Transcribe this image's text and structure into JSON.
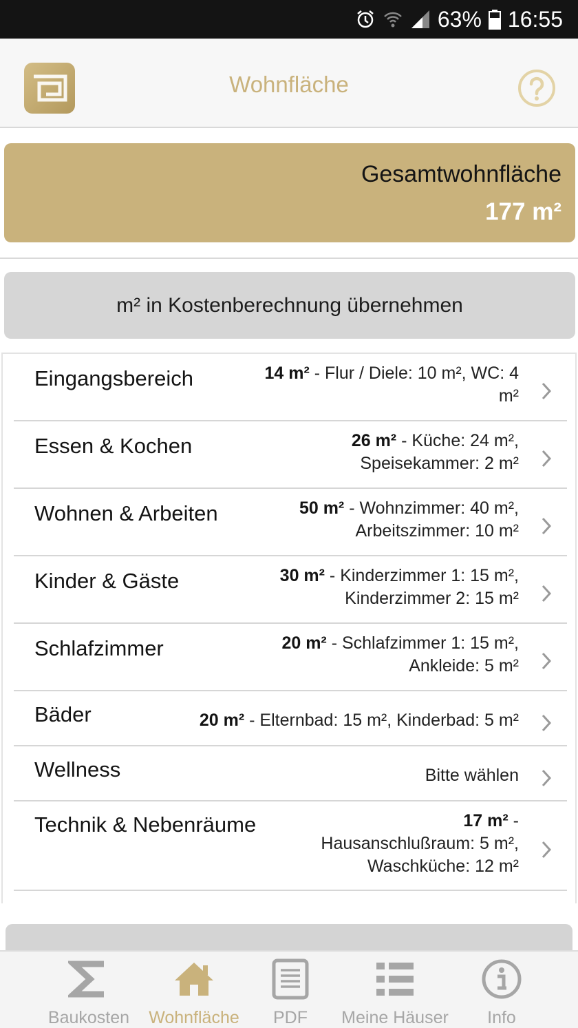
{
  "status_bar": {
    "battery": "63%",
    "time": "16:55"
  },
  "header": {
    "title": "Wohnfläche",
    "logo_icon": "app-logo-icon",
    "help_icon": "question-circle-icon"
  },
  "total": {
    "label": "Gesamtwohnfläche",
    "value": "177 m²"
  },
  "apply_button": {
    "label": "m² in Kostenberechnung übernehmen"
  },
  "rooms": [
    {
      "title": "Eingangsbereich",
      "size": "14 m²",
      "desc_line1": " - Flur / Diele: 10 m², WC: 4",
      "desc_line2": "m²"
    },
    {
      "title": "Essen & Kochen",
      "size": "26 m²",
      "desc_line1": " - Küche: 24 m²,",
      "desc_line2": "Speisekammer: 2 m²"
    },
    {
      "title": "Wohnen & Arbeiten",
      "size": "50 m²",
      "desc_line1": " - Wohnzimmer: 40 m²,",
      "desc_line2": "Arbeitszimmer: 10 m²"
    },
    {
      "title": "Kinder & Gäste",
      "size": "30 m²",
      "desc_line1": " - Kinderzimmer 1: 15 m²,",
      "desc_line2": "Kinderzimmer 2: 15 m²"
    },
    {
      "title": "Schlafzimmer",
      "size": "20 m²",
      "desc_line1": " - Schlafzimmer 1: 15 m²,",
      "desc_line2": "Ankleide: 5 m²"
    },
    {
      "title": "Bäder",
      "size": "20 m²",
      "desc_line1": " - Elternbad: 15 m², Kinderbad: 5 m²"
    },
    {
      "title": "Wellness",
      "desc_line1": "Bitte wählen"
    },
    {
      "title": "Technik & Nebenräume",
      "size": "17 m²",
      "desc_line1": " -",
      "desc_line2": "Hausanschlußraum: 5 m²,",
      "desc_line3": "Waschküche: 12 m²"
    }
  ],
  "bottom_nav": [
    {
      "label": "Baukosten",
      "icon": "sigma-icon",
      "active": false
    },
    {
      "label": "Wohnfläche",
      "icon": "house-icon",
      "active": true
    },
    {
      "label": "PDF",
      "icon": "document-icon",
      "active": false
    },
    {
      "label": "Meine Häuser",
      "icon": "list-icon",
      "active": false
    },
    {
      "label": "Info",
      "icon": "info-icon",
      "active": false
    }
  ],
  "colors": {
    "accent": "#c9b27c",
    "inactive": "#a6a6a6",
    "button": "#d6d6d6"
  }
}
